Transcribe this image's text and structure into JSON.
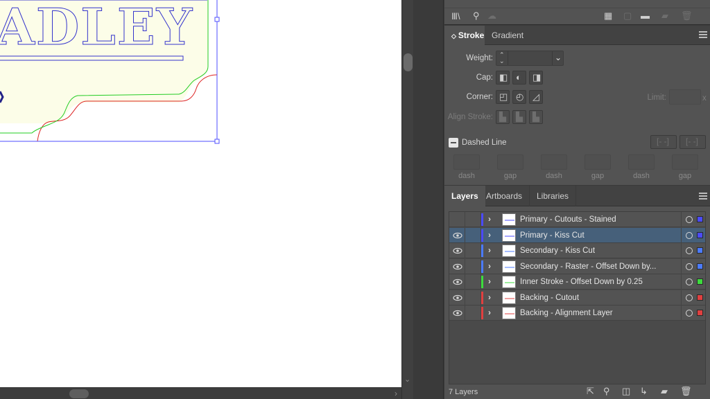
{
  "artwork": {
    "visible_text": "ADLEY",
    "colors": {
      "outline_blue": "#3333cc",
      "green": "#22cc22",
      "red": "#dd2222",
      "fill": "#fcfde8",
      "selection": "#4d4dff"
    }
  },
  "libraries_strip": {
    "icons": [
      "libraries-icon",
      "link-icon",
      "cloud-icon",
      "grid-icon",
      "document-icon",
      "folder-icon",
      "new-item-icon",
      "trash-icon"
    ]
  },
  "stroke_panel": {
    "tabs": [
      {
        "label": "Stroke",
        "active": true
      },
      {
        "label": "Gradient",
        "active": false
      }
    ],
    "weight_label": "Weight:",
    "weight_value": "",
    "cap_label": "Cap:",
    "corner_label": "Corner:",
    "limit_label": "Limit:",
    "limit_unit": "x",
    "align_label": "Align Stroke:",
    "dashed_label": "Dashed Line",
    "dash_fields": [
      "dash",
      "gap",
      "dash",
      "gap",
      "dash",
      "gap"
    ]
  },
  "layers_panel": {
    "tabs": [
      {
        "label": "Layers",
        "active": true
      },
      {
        "label": "Artboards",
        "active": false
      },
      {
        "label": "Libraries",
        "active": false
      }
    ],
    "layers": [
      {
        "name": "Primary - Cutouts - Stained",
        "visible": false,
        "color": "#4b4bff",
        "selected": false
      },
      {
        "name": "Primary - Kiss Cut",
        "visible": true,
        "color": "#4b4bff",
        "selected": true
      },
      {
        "name": "Secondary - Kiss Cut",
        "visible": true,
        "color": "#4b7bff",
        "selected": false
      },
      {
        "name": "Secondary - Raster - Offset Down by...",
        "visible": true,
        "color": "#4b7bff",
        "selected": false
      },
      {
        "name": "Inner Stroke - Offset Down by 0.25",
        "visible": true,
        "color": "#3ddc3d",
        "selected": false
      },
      {
        "name": "Backing - Cutout",
        "visible": true,
        "color": "#e04040",
        "selected": false
      },
      {
        "name": "Backing - Alignment Layer",
        "visible": true,
        "color": "#e04040",
        "selected": false
      }
    ],
    "count_label": "7 Layers",
    "footer_icons": [
      "export-icon",
      "locate-icon",
      "clip-mask-icon",
      "sublayer-icon",
      "new-layer-icon",
      "trash-icon"
    ]
  }
}
